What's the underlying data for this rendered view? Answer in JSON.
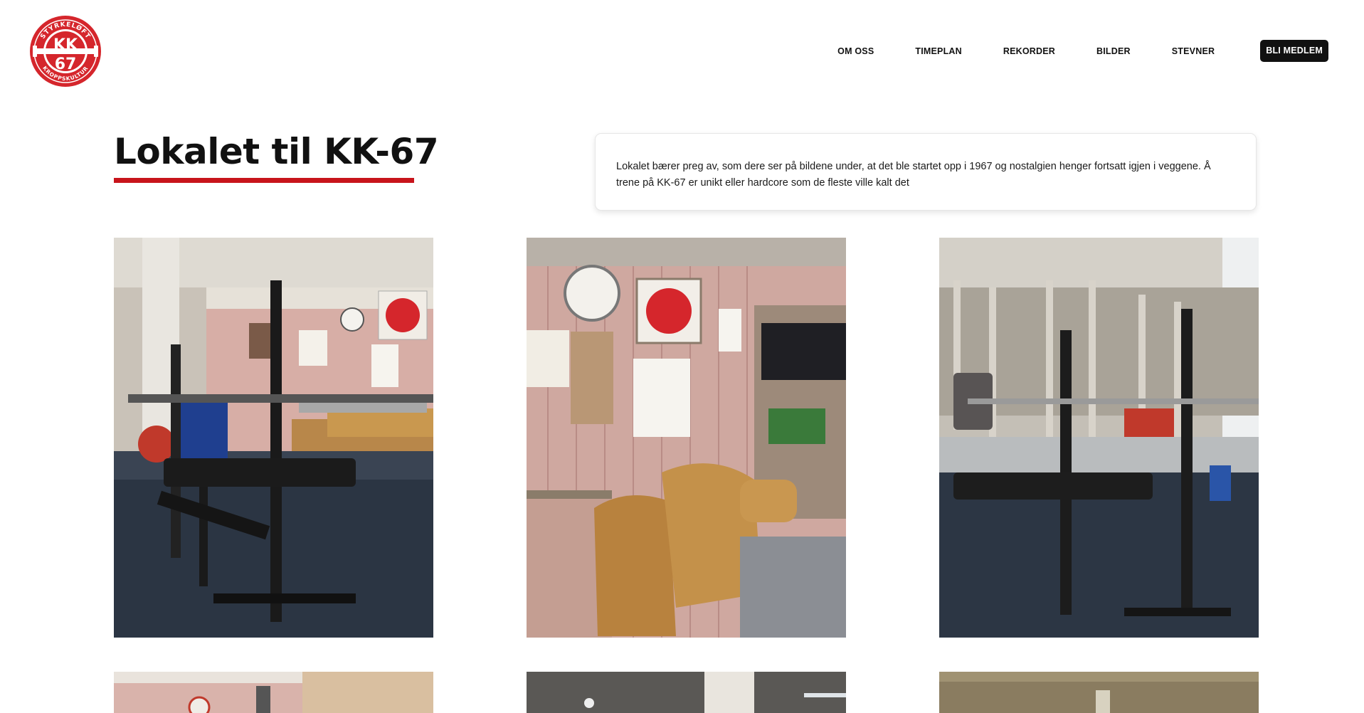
{
  "brand": {
    "logo_top_text": "STYRKELØFT",
    "logo_bottom_text": "KROPPSKULTUR",
    "logo_line1": "KK",
    "logo_line2": "67",
    "color_red": "#d5262c"
  },
  "nav": {
    "items": [
      {
        "label": "OM OSS"
      },
      {
        "label": "TIMEPLAN"
      },
      {
        "label": "REKORDER"
      },
      {
        "label": "BILDER"
      },
      {
        "label": "STEVNER"
      }
    ],
    "cta_label": "BLI MEDLEM"
  },
  "main": {
    "title": "Lokalet til KK-67",
    "intro": "Lokalet bærer preg av, som dere ser på bildene under, at det ble startet opp i 1967 og nostalgien henger fortsatt igjen i veggene. Å trene på KK-67 er unikt eller hardcore som de fleste ville kalt det"
  },
  "gallery": {
    "photos": [
      {
        "subject": "bench-press-rack-with-pink-walls"
      },
      {
        "subject": "leather-sofas-and-noticeboard"
      },
      {
        "subject": "bench-press-rack-and-squat-cages"
      },
      {
        "subject": "pink-wall-room"
      },
      {
        "subject": "basement-ceiling-with-lamp"
      },
      {
        "subject": "basement-corridor"
      }
    ]
  },
  "colors": {
    "accent": "#c8141b",
    "button_bg": "#111111",
    "carpet": "#2b3543",
    "wall_pink": "#d8b3ac",
    "leather": "#c08b45"
  }
}
